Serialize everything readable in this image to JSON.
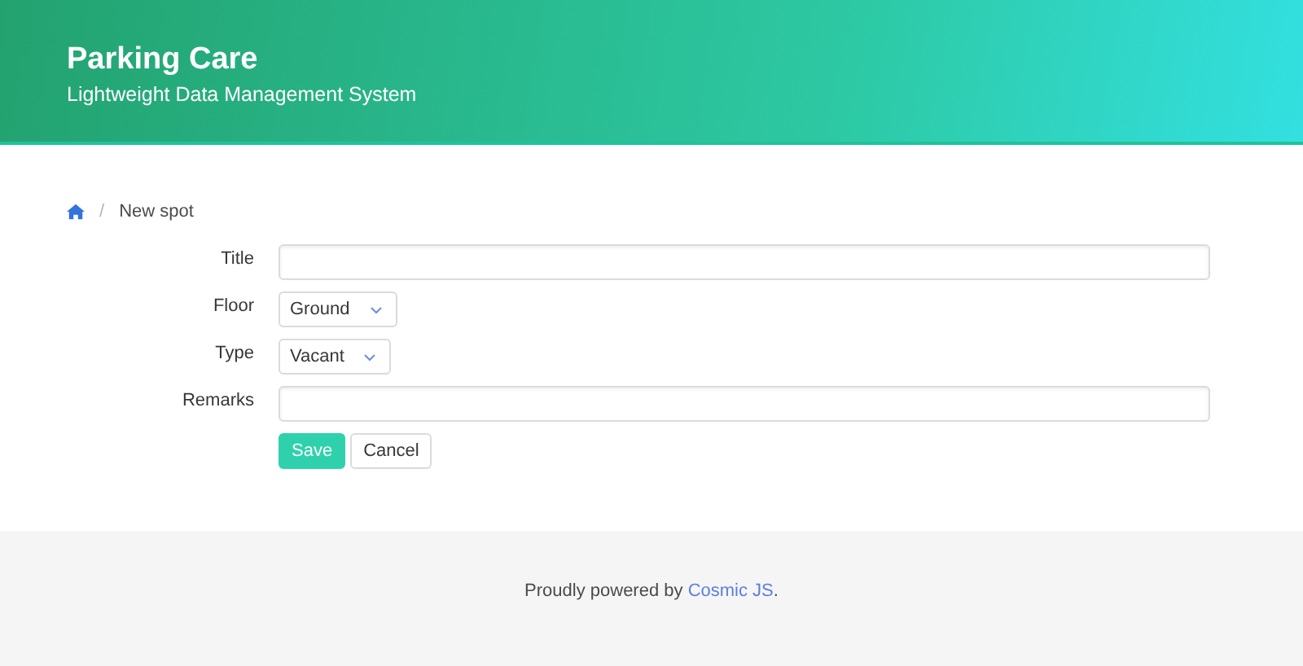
{
  "header": {
    "title": "Parking Care",
    "subtitle": "Lightweight Data Management System"
  },
  "breadcrumb": {
    "separator": "/",
    "current": "New spot"
  },
  "form": {
    "fields": [
      {
        "kind": "text",
        "label": "Title"
      },
      {
        "kind": "select",
        "label": "Floor",
        "value": "Ground"
      },
      {
        "kind": "select",
        "label": "Type",
        "value": "Vacant"
      },
      {
        "kind": "text",
        "label": "Remarks"
      }
    ],
    "buttons": [
      {
        "kind": "primary",
        "label": "Save"
      },
      {
        "kind": "default",
        "label": "Cancel"
      }
    ]
  },
  "footer": {
    "text": "Proudly powered by",
    "link": "Cosmic JS",
    "suffix": "."
  }
}
